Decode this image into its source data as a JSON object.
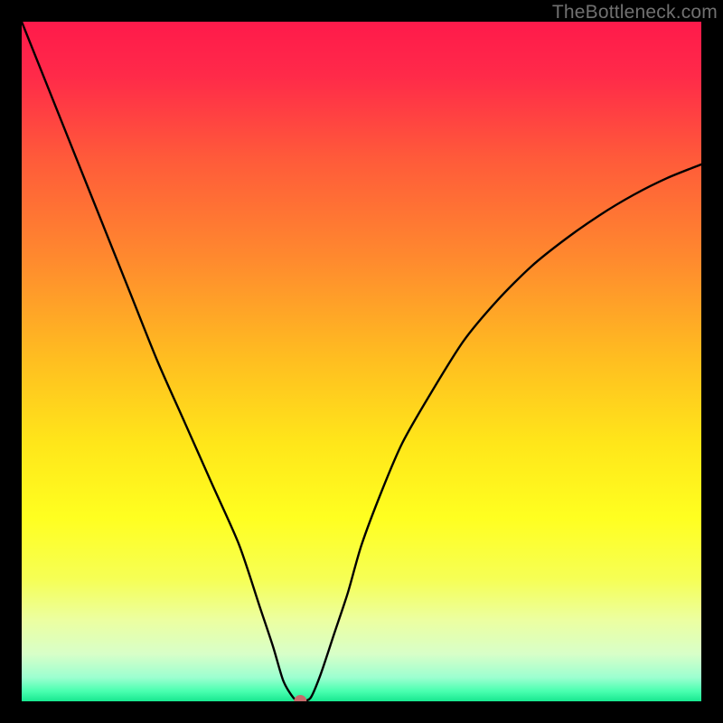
{
  "watermark": "TheBottleneck.com",
  "chart_data": {
    "type": "line",
    "title": "",
    "xlabel": "",
    "ylabel": "",
    "xlim": [
      0,
      100
    ],
    "ylim": [
      0,
      100
    ],
    "gradient_stops": [
      {
        "offset": 0,
        "color": "#ff1a4b"
      },
      {
        "offset": 0.08,
        "color": "#ff2a49"
      },
      {
        "offset": 0.2,
        "color": "#ff5a3a"
      },
      {
        "offset": 0.35,
        "color": "#ff8a2e"
      },
      {
        "offset": 0.5,
        "color": "#ffbf20"
      },
      {
        "offset": 0.62,
        "color": "#ffe61a"
      },
      {
        "offset": 0.73,
        "color": "#ffff20"
      },
      {
        "offset": 0.82,
        "color": "#f6ff55"
      },
      {
        "offset": 0.88,
        "color": "#ecffa0"
      },
      {
        "offset": 0.93,
        "color": "#d8ffc8"
      },
      {
        "offset": 0.965,
        "color": "#9cffd0"
      },
      {
        "offset": 0.985,
        "color": "#4affb0"
      },
      {
        "offset": 1.0,
        "color": "#18e890"
      }
    ],
    "series": [
      {
        "name": "bottleneck-curve",
        "x": [
          0,
          4,
          8,
          12,
          16,
          20,
          24,
          28,
          32,
          35,
          37,
          38.5,
          40,
          41,
          42.5,
          44,
          46,
          48,
          50,
          53,
          56,
          60,
          65,
          70,
          75,
          80,
          85,
          90,
          95,
          100
        ],
        "y": [
          100,
          90,
          80,
          70,
          60,
          50,
          41,
          32,
          23,
          14,
          8,
          3,
          0.5,
          0,
          0.5,
          4,
          10,
          16,
          23,
          31,
          38,
          45,
          53,
          59,
          64,
          68,
          71.5,
          74.5,
          77,
          79
        ]
      }
    ],
    "marker": {
      "x": 41,
      "y": 0,
      "color": "#c66b6b",
      "radius": 7
    },
    "flat_bottom": {
      "x_start": 38.5,
      "x_end": 42.5,
      "y": 0
    }
  }
}
